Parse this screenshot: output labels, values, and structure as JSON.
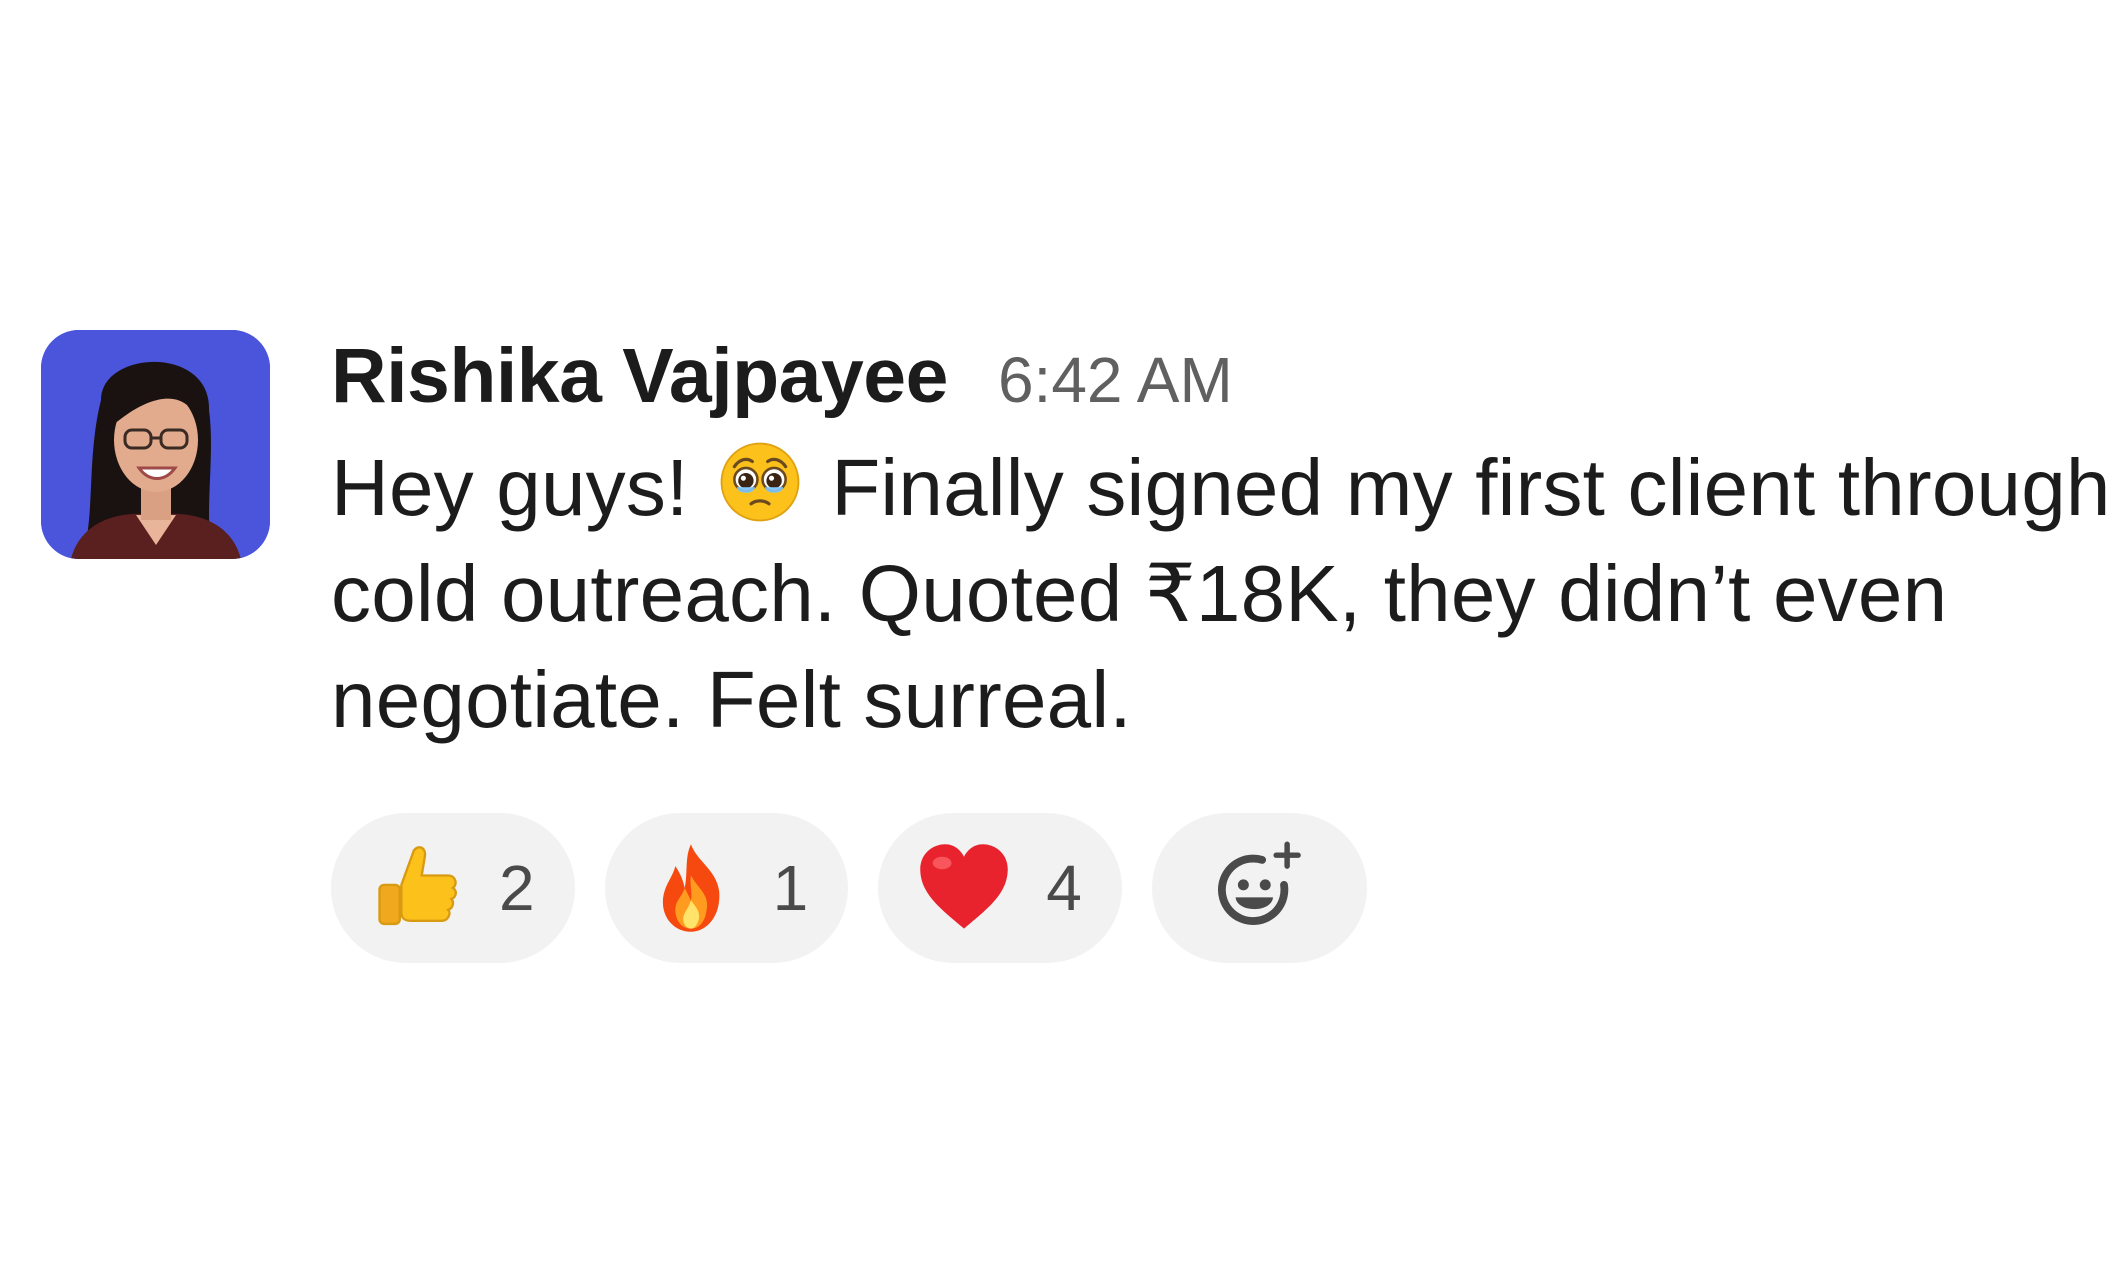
{
  "message": {
    "sender": "Rishika Vajpayee",
    "timestamp": "6:42 AM",
    "text_part1": "Hey guys!",
    "inline_emoji": "pleading-face-with-tears",
    "text_part2": "Finally signed my first client through cold outreach. Quoted ₹18K, they didn’t even negotiate. Felt surreal."
  },
  "reactions": [
    {
      "emoji": "thumbs-up",
      "count": "2"
    },
    {
      "emoji": "fire",
      "count": "1"
    },
    {
      "emoji": "red-heart",
      "count": "4"
    }
  ],
  "add_reaction": {
    "icon": "add-emoji-icon"
  },
  "colors": {
    "avatar_bg": "#4a55dc",
    "reaction_bg": "#f2f2f2",
    "text": "#1d1c1d",
    "muted": "#616061"
  }
}
